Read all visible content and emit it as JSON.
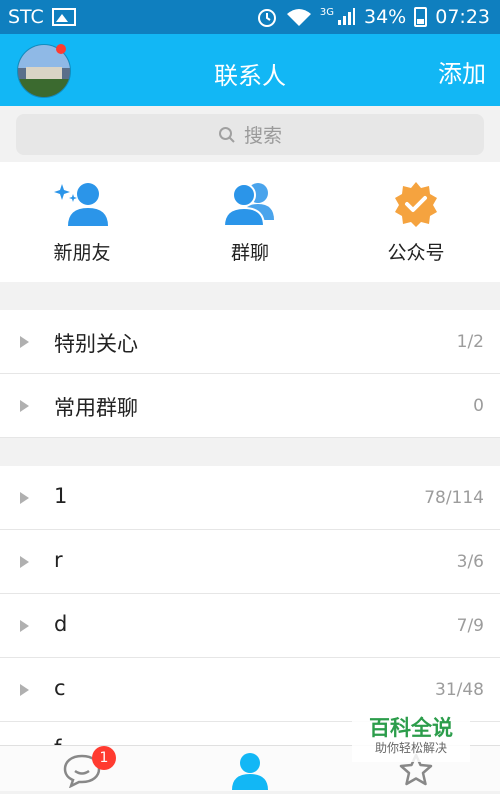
{
  "status_bar": {
    "carrier": "STC",
    "network": "3G",
    "battery": "34%",
    "time": "07:23"
  },
  "header": {
    "title": "联系人",
    "add_label": "添加"
  },
  "search": {
    "placeholder": "搜索"
  },
  "quick_actions": [
    {
      "label": "新朋友",
      "icon": "new-friend-icon"
    },
    {
      "label": "群聊",
      "icon": "group-chat-icon"
    },
    {
      "label": "公众号",
      "icon": "official-account-icon"
    }
  ],
  "special_groups": [
    {
      "name": "特别关心",
      "count": "1/2"
    },
    {
      "name": "常用群聊",
      "count": "0"
    }
  ],
  "friend_groups": [
    {
      "name": "1",
      "count": "78/114"
    },
    {
      "name": "r",
      "count": "3/6"
    },
    {
      "name": "d",
      "count": "7/9"
    },
    {
      "name": "c",
      "count": "31/48"
    },
    {
      "name": "f",
      "count": ""
    }
  ],
  "tab_bar": {
    "messages_badge": "1",
    "tabs": [
      "message-icon",
      "contacts-icon",
      "favorites-icon"
    ]
  },
  "watermark": {
    "brand": "百科全说",
    "slogan": "助你轻松解决"
  },
  "colors": {
    "header": "#12b7f5",
    "status_bar": "#0f7fbf",
    "icon_blue": "#2b95e9",
    "icon_orange": "#f5a33f",
    "badge": "#ff3b30"
  }
}
